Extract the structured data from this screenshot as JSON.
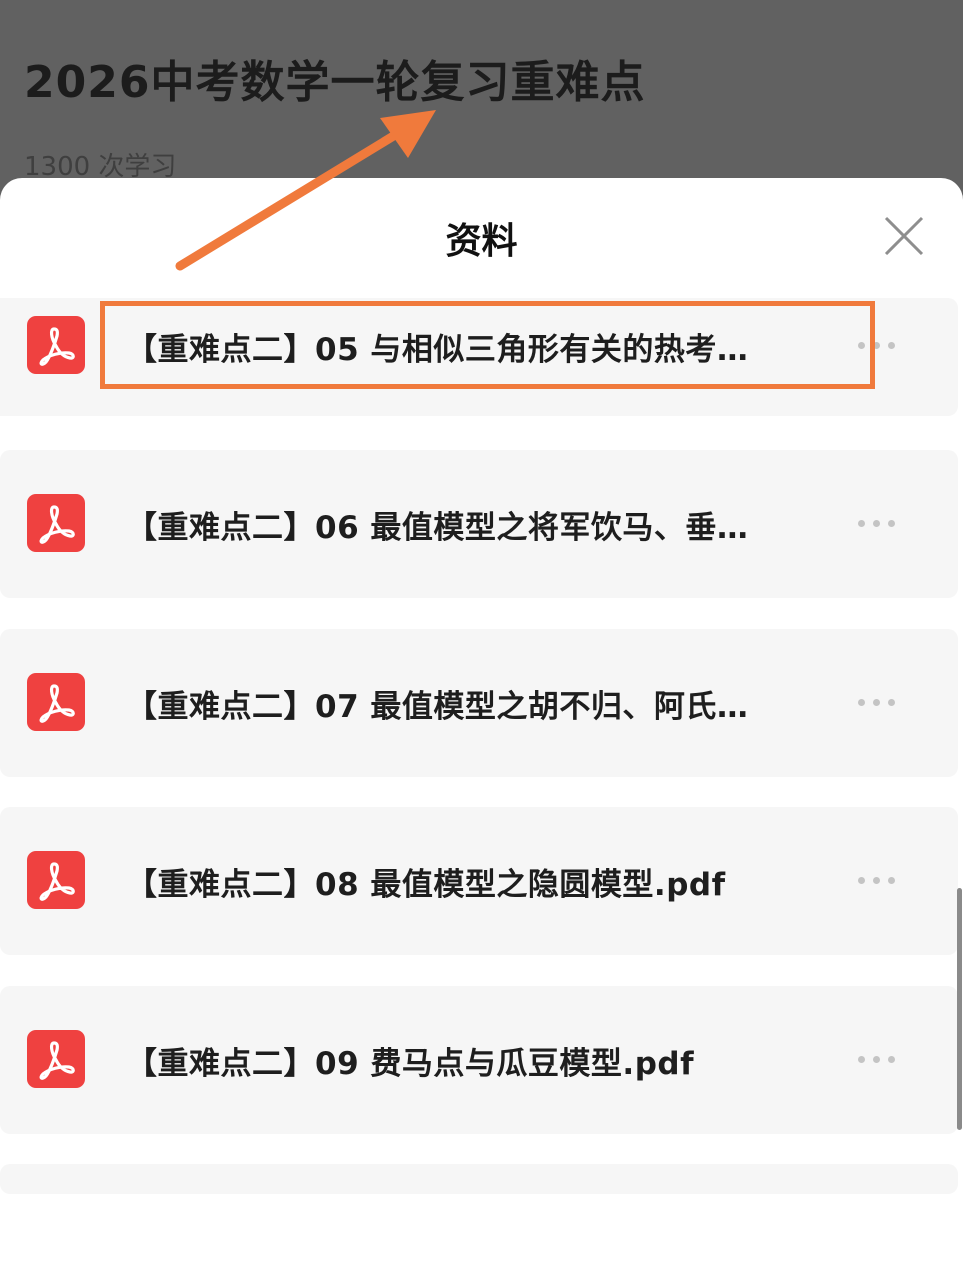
{
  "page": {
    "course_title": "2026中考数学一轮复习重难点",
    "study_count": "1300 次学习"
  },
  "sheet": {
    "title": "资料",
    "close_icon": "close-icon"
  },
  "files": [
    {
      "name": "【重难点二】05 与相似三角形有关的热考…",
      "icon": "pdf-icon"
    },
    {
      "name": "【重难点二】06 最值模型之将军饮马、垂…",
      "icon": "pdf-icon"
    },
    {
      "name": "【重难点二】07 最值模型之胡不归、阿氏…",
      "icon": "pdf-icon"
    },
    {
      "name": "【重难点二】08 最值模型之隐圆模型.pdf",
      "icon": "pdf-icon"
    },
    {
      "name": "【重难点二】09 费马点与瓜豆模型.pdf",
      "icon": "pdf-icon"
    }
  ],
  "annotation": {
    "color": "#f07a3c",
    "highlighted_item": "【重难点二】05 与相似三角形有关的热考…"
  },
  "colors": {
    "pdf_icon_bg": "#ef4140",
    "overlay": "#616161",
    "row_bg": "#f6f6f6"
  }
}
